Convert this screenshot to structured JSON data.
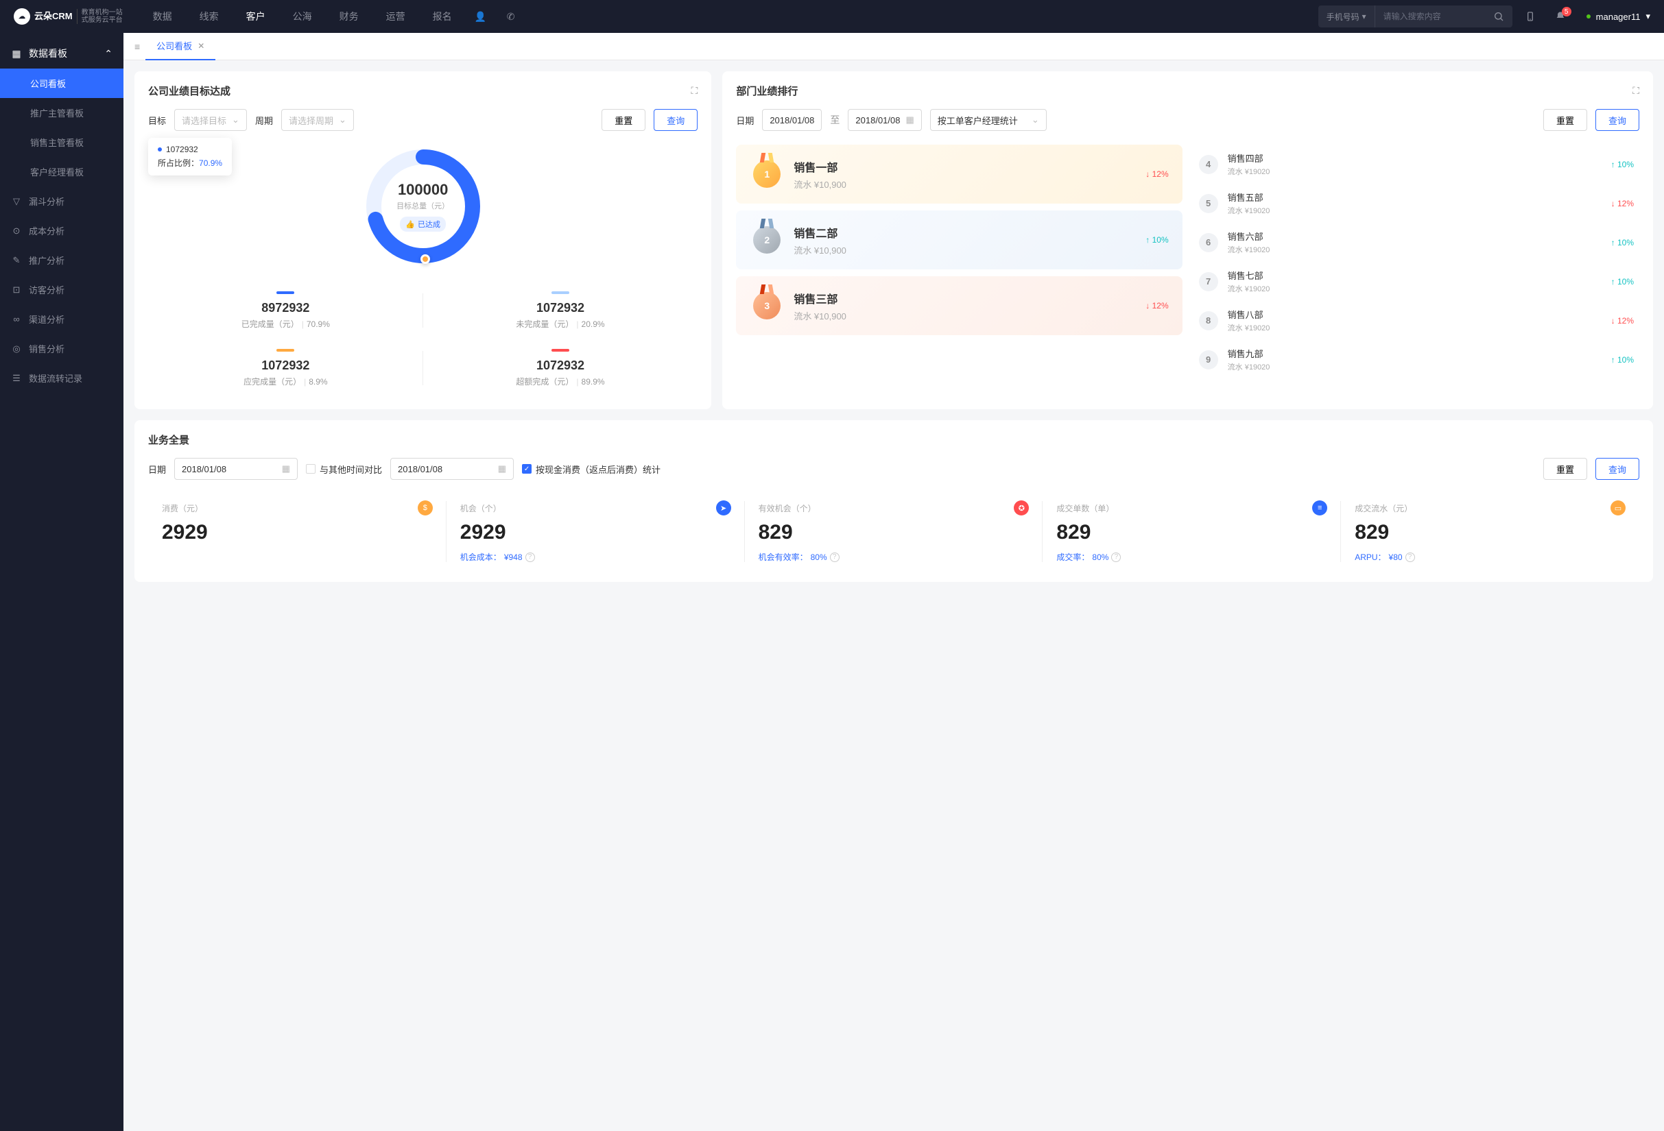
{
  "brand": {
    "main": "云朵CRM",
    "sub1": "教育机构一站",
    "sub2": "式服务云平台"
  },
  "topnav": [
    "数据",
    "线索",
    "客户",
    "公海",
    "财务",
    "运营",
    "报名"
  ],
  "topnav_active": 2,
  "search": {
    "type": "手机号码",
    "placeholder": "请输入搜索内容"
  },
  "notif_count": "5",
  "user": "manager11",
  "sidebar": {
    "group": {
      "title": "数据看板",
      "items": [
        "公司看板",
        "推广主管看板",
        "销售主管看板",
        "客户经理看板"
      ],
      "active": 0
    },
    "singles": [
      "漏斗分析",
      "成本分析",
      "推广分析",
      "访客分析",
      "渠道分析",
      "销售分析",
      "数据流转记录"
    ]
  },
  "tab": {
    "label": "公司看板"
  },
  "panel1": {
    "title": "公司业绩目标达成",
    "target_label": "目标",
    "target_placeholder": "请选择目标",
    "period_label": "周期",
    "period_placeholder": "请选择周期",
    "reset": "重置",
    "query": "查询",
    "tooltip": {
      "value": "1072932",
      "ratio_label": "所占比例：",
      "ratio": "70.9%"
    },
    "donut": {
      "value": "100000",
      "label": "目标总量（元）",
      "badge": "已达成",
      "pct": 70.9
    },
    "stats": [
      {
        "bar": "#2f6bff",
        "val": "8972932",
        "lbl": "已完成量（元）",
        "pct": "70.9%"
      },
      {
        "bar": "#a9cfff",
        "val": "1072932",
        "lbl": "未完成量（元）",
        "pct": "20.9%"
      },
      {
        "bar": "#ffa940",
        "val": "1072932",
        "lbl": "应完成量（元）",
        "pct": "8.9%"
      },
      {
        "bar": "#ff4d4f",
        "val": "1072932",
        "lbl": "超额完成（元）",
        "pct": "89.9%"
      }
    ]
  },
  "panel2": {
    "title": "部门业绩排行",
    "date_label": "日期",
    "date_from": "2018/01/08",
    "date_to": "2018/01/08",
    "to_text": "至",
    "stat_by": "按工单客户经理统计",
    "reset": "重置",
    "query": "查询",
    "top3": [
      {
        "cls": "gold",
        "rank": "1",
        "name": "销售一部",
        "amount": "流水 ¥10,900",
        "pct": "12%",
        "dir": "down"
      },
      {
        "cls": "silver",
        "rank": "2",
        "name": "销售二部",
        "amount": "流水 ¥10,900",
        "pct": "10%",
        "dir": "up"
      },
      {
        "cls": "bronze",
        "rank": "3",
        "name": "销售三部",
        "amount": "流水 ¥10,900",
        "pct": "12%",
        "dir": "down"
      }
    ],
    "rest": [
      {
        "rank": "4",
        "name": "销售四部",
        "amount": "流水 ¥19020",
        "pct": "10%",
        "dir": "up"
      },
      {
        "rank": "5",
        "name": "销售五部",
        "amount": "流水 ¥19020",
        "pct": "12%",
        "dir": "down"
      },
      {
        "rank": "6",
        "name": "销售六部",
        "amount": "流水 ¥19020",
        "pct": "10%",
        "dir": "up"
      },
      {
        "rank": "7",
        "name": "销售七部",
        "amount": "流水 ¥19020",
        "pct": "10%",
        "dir": "up"
      },
      {
        "rank": "8",
        "name": "销售八部",
        "amount": "流水 ¥19020",
        "pct": "12%",
        "dir": "down"
      },
      {
        "rank": "9",
        "name": "销售九部",
        "amount": "流水 ¥19020",
        "pct": "10%",
        "dir": "up"
      }
    ]
  },
  "panel3": {
    "title": "业务全景",
    "date_label": "日期",
    "date1": "2018/01/08",
    "compare_label": "与其他时间对比",
    "date2": "2018/01/08",
    "cb_label": "按现金消费（返点后消费）统计",
    "reset": "重置",
    "query": "查询",
    "cards": [
      {
        "label": "消费（元）",
        "icon_bg": "#ffa940",
        "glyph": "$",
        "val": "2929",
        "sub_label": "",
        "sub_val": ""
      },
      {
        "label": "机会（个）",
        "icon_bg": "#2f6bff",
        "glyph": "➤",
        "val": "2929",
        "sub_label": "机会成本：",
        "sub_val": "¥948"
      },
      {
        "label": "有效机会（个）",
        "icon_bg": "#ff4d4f",
        "glyph": "✪",
        "val": "829",
        "sub_label": "机会有效率：",
        "sub_val": "80%"
      },
      {
        "label": "成交单数（单）",
        "icon_bg": "#2f6bff",
        "glyph": "≡",
        "val": "829",
        "sub_label": "成交率：",
        "sub_val": "80%"
      },
      {
        "label": "成交流水（元）",
        "icon_bg": "#ffa940",
        "glyph": "▭",
        "val": "829",
        "sub_label": "ARPU：",
        "sub_val": "¥80"
      }
    ]
  },
  "chart_data": {
    "type": "pie",
    "title": "目标总量（元）",
    "total": 100000,
    "series": [
      {
        "name": "已完成量（元）",
        "value": 8972932,
        "pct": 70.9,
        "color": "#2f6bff"
      },
      {
        "name": "未完成量（元）",
        "value": 1072932,
        "pct": 20.9,
        "color": "#a9cfff"
      },
      {
        "name": "应完成量（元）",
        "value": 1072932,
        "pct": 8.9,
        "color": "#ffa940"
      },
      {
        "name": "超额完成（元）",
        "value": 1072932,
        "pct": 89.9,
        "color": "#ff4d4f"
      }
    ]
  }
}
